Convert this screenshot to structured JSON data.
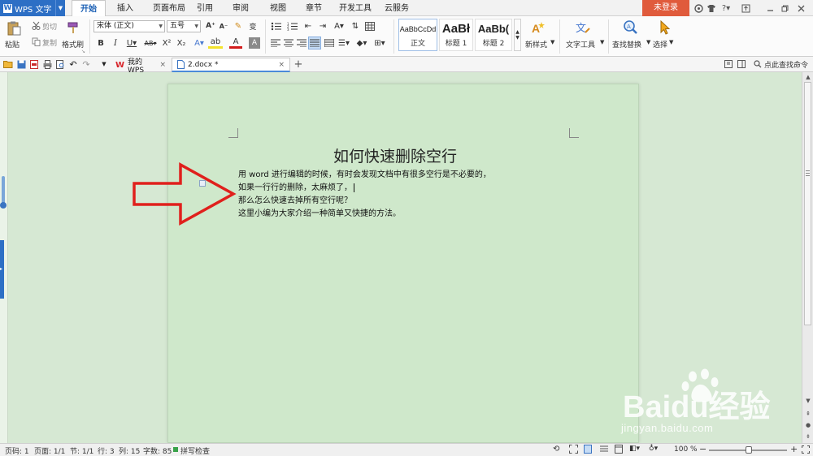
{
  "app": {
    "name": "WPS 文字",
    "login_label": "未登录"
  },
  "menu": {
    "tabs": [
      {
        "label": "开始",
        "active": true
      },
      {
        "label": "插入"
      },
      {
        "label": "页面布局"
      },
      {
        "label": "引用"
      },
      {
        "label": "审阅"
      },
      {
        "label": "视图"
      },
      {
        "label": "章节"
      },
      {
        "label": "开发工具"
      },
      {
        "label": "云服务"
      }
    ]
  },
  "ribbon": {
    "paste": "粘贴",
    "cut": "剪切",
    "copy": "复制",
    "format_painter": "格式刷",
    "font_name": "宋体 (正文)",
    "font_size": "五号",
    "styles": [
      {
        "sample": "AaBbCcDd",
        "name": "正文"
      },
      {
        "sample": "AaBł",
        "name": "标题 1"
      },
      {
        "sample": "AaBb(",
        "name": "标题 2"
      }
    ],
    "new_style": "新样式",
    "text_tools": "文字工具",
    "find_replace": "查找替换",
    "select": "选择"
  },
  "tabs_bar": {
    "tabs": [
      {
        "label": "我的WPS"
      },
      {
        "label": "2.docx *",
        "active": true
      }
    ],
    "search_command": "点此查找命令"
  },
  "document": {
    "title": "如何快速删除空行",
    "lines": [
      "用 word 进行编辑的时候，有时会发现文档中有很多空行是不必要的，",
      "如果一行行的删除，太麻烦了，",
      "那么怎么快速去掉所有空行呢？",
      "这里小编为大家介绍一种简单又快捷的方法。"
    ]
  },
  "status": {
    "page_num": "页码: 1",
    "pages": "页面: 1/1",
    "section": "节: 1/1",
    "row": "行: 3",
    "col": "列: 15",
    "word_count": "字数: 85",
    "spell_check": "拼写检查",
    "zoom": "100 %",
    "zoom_fraction": 0.5
  },
  "watermark": {
    "brand": "Baidu经验",
    "url": "jingyan.baidu.com"
  },
  "colors": {
    "accent_blue": "#2d6fc5",
    "login_red": "#e05b3c",
    "arrow_red": "#e0201c",
    "page_bg": "#cfe8cb"
  }
}
